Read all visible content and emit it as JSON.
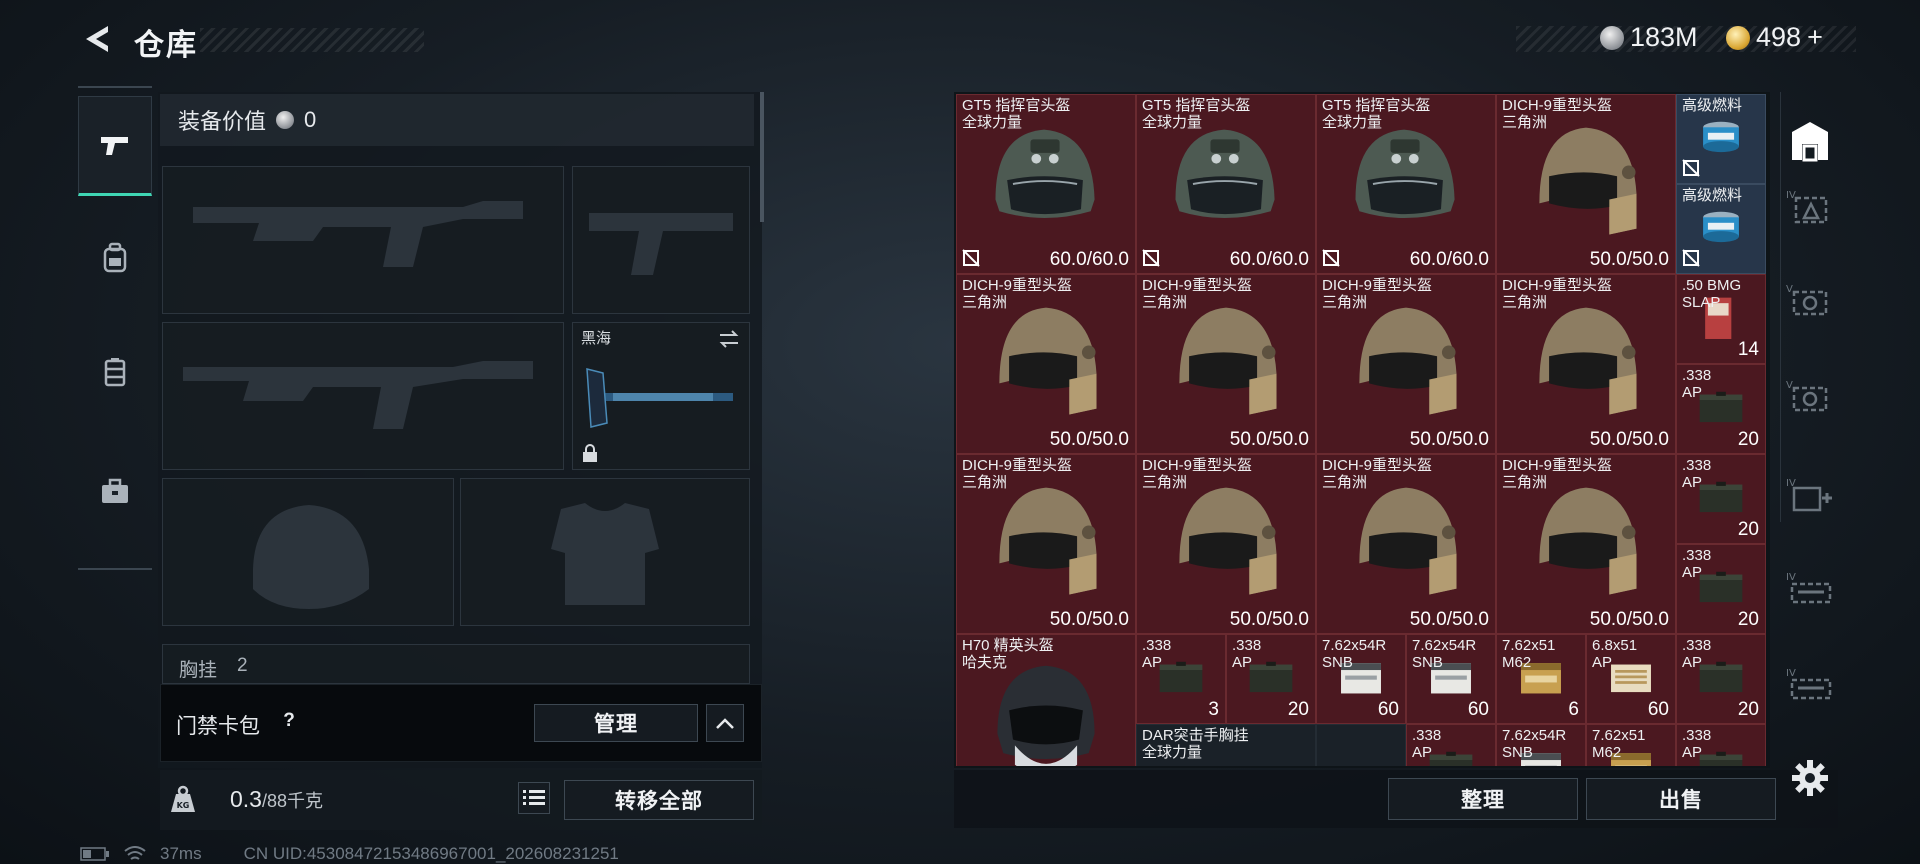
{
  "header": {
    "title": "仓库"
  },
  "currencies": [
    {
      "icon": "silver-coin-icon",
      "value": "183M"
    },
    {
      "icon": "gold-coin-icon",
      "value": "498",
      "suffix": "+"
    }
  ],
  "rail": [
    "pistol-icon",
    "backpack-icon",
    "chest-rig-icon",
    "briefcase-icon"
  ],
  "equipment": {
    "value_label": "装备价值",
    "value": "0",
    "melee_label": "黑海",
    "partial_label": "胸挂",
    "partial_count": "2"
  },
  "keycard": {
    "label": "门禁卡包",
    "help": "?",
    "manage_label": "管理"
  },
  "bottom": {
    "weight": "0.3",
    "weight_max": "/88千克",
    "transfer_all_label": "转移全部",
    "sort_label": "整理",
    "sell_label": "出售"
  },
  "status": {
    "ping": "37ms",
    "uid": "CN UID:45308472153486967001_202608231251"
  },
  "grid": {
    "big_items": [
      {
        "name1": "GT5 指挥官头盔",
        "name2": "全球力量",
        "count": "60.0/60.0",
        "icon": "helmet-gt5",
        "no_durability": true
      },
      {
        "name1": "GT5 指挥官头盔",
        "name2": "全球力量",
        "count": "60.0/60.0",
        "icon": "helmet-gt5",
        "no_durability": true
      },
      {
        "name1": "GT5 指挥官头盔",
        "name2": "全球力量",
        "count": "60.0/60.0",
        "icon": "helmet-gt5",
        "no_durability": true
      },
      {
        "name1": "DICH-9重型头盔",
        "name2": "三角洲",
        "count": "50.0/50.0",
        "icon": "helmet-dich9",
        "no_durability": false
      },
      {
        "name1": "DICH-9重型头盔",
        "name2": "三角洲",
        "count": "50.0/50.0",
        "icon": "helmet-dich9",
        "no_durability": false
      },
      {
        "name1": "DICH-9重型头盔",
        "name2": "三角洲",
        "count": "50.0/50.0",
        "icon": "helmet-dich9",
        "no_durability": false
      },
      {
        "name1": "DICH-9重型头盔",
        "name2": "三角洲",
        "count": "50.0/50.0",
        "icon": "helmet-dich9",
        "no_durability": false
      },
      {
        "name1": "DICH-9重型头盔",
        "name2": "三角洲",
        "count": "50.0/50.0",
        "icon": "helmet-dich9",
        "no_durability": false
      },
      {
        "name1": "DICH-9重型头盔",
        "name2": "三角洲",
        "count": "50.0/50.0",
        "icon": "helmet-dich9",
        "no_durability": false
      },
      {
        "name1": "DICH-9重型头盔",
        "name2": "三角洲",
        "count": "50.0/50.0",
        "icon": "helmet-dich9",
        "no_durability": false
      },
      {
        "name1": "DICH-9重型头盔",
        "name2": "三角洲",
        "count": "50.0/50.0",
        "icon": "helmet-dich9",
        "no_durability": false
      },
      {
        "name1": "DICH-9重型头盔",
        "name2": "三角洲",
        "count": "50.0/50.0",
        "icon": "helmet-dich9",
        "no_durability": false
      },
      {
        "name1": "H70 精英头盔",
        "name2": "哈夫克",
        "count": "",
        "icon": "helmet-h70",
        "no_durability": false
      }
    ],
    "small_items": [
      {
        "name1": "高级燃料",
        "name2": "",
        "count": "",
        "icon": "fuel-can",
        "no_durability": true,
        "blue": true
      },
      {
        "name1": "高级燃料",
        "name2": "",
        "count": "",
        "icon": "fuel-can",
        "no_durability": true,
        "blue": true
      },
      {
        "name1": ".50 BMG",
        "name2": "SLAP",
        "count": "14",
        "icon": "ammo-box-red"
      },
      {
        "name1": ".338",
        "name2": "AP",
        "count": "20",
        "icon": "ammo-box-dark"
      },
      {
        "name1": ".338",
        "name2": "AP",
        "count": "20",
        "icon": "ammo-box-dark"
      },
      {
        "name1": ".338",
        "name2": "AP",
        "count": "20",
        "icon": "ammo-box-dark"
      },
      {
        "name1": ".338",
        "name2": "AP",
        "count": "3",
        "icon": "ammo-box-dark"
      },
      {
        "name1": ".338",
        "name2": "AP",
        "count": "20",
        "icon": "ammo-box-dark"
      },
      {
        "name1": "7.62x54R",
        "name2": "SNB",
        "count": "60",
        "icon": "ammo-box-white"
      },
      {
        "name1": "7.62x54R",
        "name2": "SNB",
        "count": "60",
        "icon": "ammo-box-white"
      },
      {
        "name1": "7.62x51",
        "name2": "M62",
        "count": "6",
        "icon": "ammo-box-tan"
      },
      {
        "name1": "6.8x51",
        "name2": "AP",
        "count": "60",
        "icon": "ammo-box-cream"
      },
      {
        "name1": ".338",
        "name2": "AP",
        "count": "20",
        "icon": "ammo-box-dark"
      },
      {
        "name1": ".338",
        "name2": "AP",
        "count": "",
        "icon": "ammo-box-dark"
      },
      {
        "name1": "7.62x54R",
        "name2": "SNB",
        "count": "",
        "icon": "ammo-box-white"
      },
      {
        "name1": "7.62x51",
        "name2": "M62",
        "count": "",
        "icon": "ammo-box-tan"
      },
      {
        "name1": ".338",
        "name2": "AP",
        "count": "",
        "icon": "ammo-box-dark"
      }
    ],
    "chest_rig": {
      "name1": "DAR突击手胸挂",
      "name2": "全球力量"
    }
  },
  "side_rail": [
    "vault-icon",
    "container-iv-icon",
    "container-v-icon",
    "container-v2-icon",
    "medkit-iv-icon",
    "weapon-iv-icon",
    "weapon-iv2-icon",
    "gear-icon"
  ]
}
